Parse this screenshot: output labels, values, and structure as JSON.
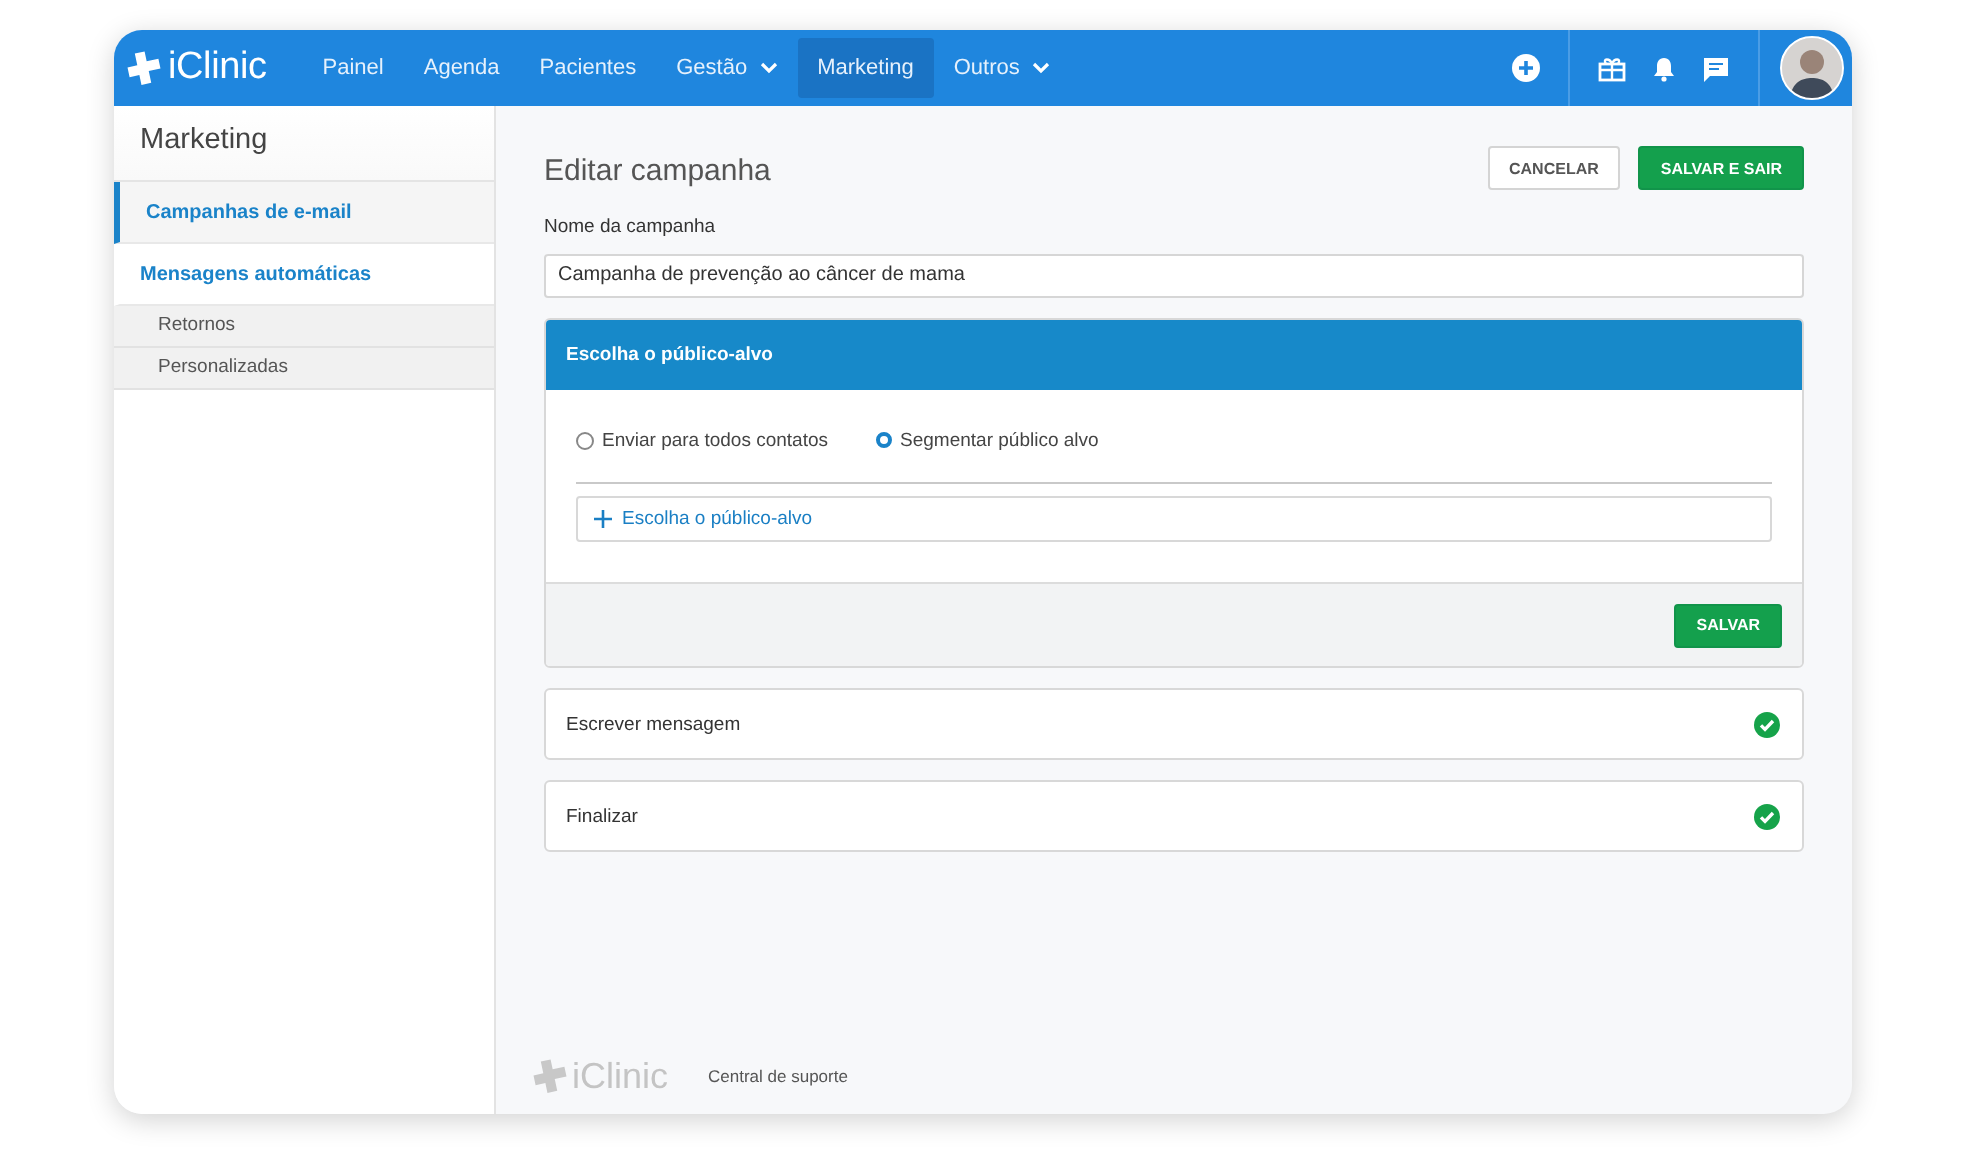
{
  "brand": {
    "name": "iClinic"
  },
  "nav": [
    {
      "label": "Painel",
      "selected": false,
      "dropdown": false
    },
    {
      "label": "Agenda",
      "selected": false,
      "dropdown": false
    },
    {
      "label": "Pacientes",
      "selected": false,
      "dropdown": false
    },
    {
      "label": "Gestão",
      "selected": false,
      "dropdown": true
    },
    {
      "label": "Marketing",
      "selected": true,
      "dropdown": false
    },
    {
      "label": "Outros",
      "selected": false,
      "dropdown": true
    }
  ],
  "sidebar": {
    "title": "Marketing",
    "items": [
      {
        "label": "Campanhas de e-mail",
        "selected": true
      },
      {
        "label": "Mensagens automáticas",
        "selected": false,
        "children": [
          {
            "label": "Retornos",
            "selected": false
          },
          {
            "label": "Personalizadas",
            "selected": false
          }
        ]
      }
    ]
  },
  "editor": {
    "title": "Editar campanha",
    "cancel_button": "CANCELAR",
    "save_exit_button": "SALVAR E SAIR",
    "name_label": "Nome da campanha",
    "name_value": "Campanha de prevenção ao câncer de mama"
  },
  "audience": {
    "title": "Escolha o público-alvo",
    "options": [
      {
        "label": "Enviar para todos contatos",
        "selected": false
      },
      {
        "label": "Segmentar público alvo",
        "selected": true
      }
    ],
    "add_button": "Escolha o público-alvo",
    "save_button": "SALVAR"
  },
  "steps": [
    {
      "label": "Escrever mensagem",
      "done": true
    },
    {
      "label": "Finalizar",
      "done": true
    }
  ],
  "footer": {
    "brand": "iClinic",
    "link": "Central de suporte"
  }
}
